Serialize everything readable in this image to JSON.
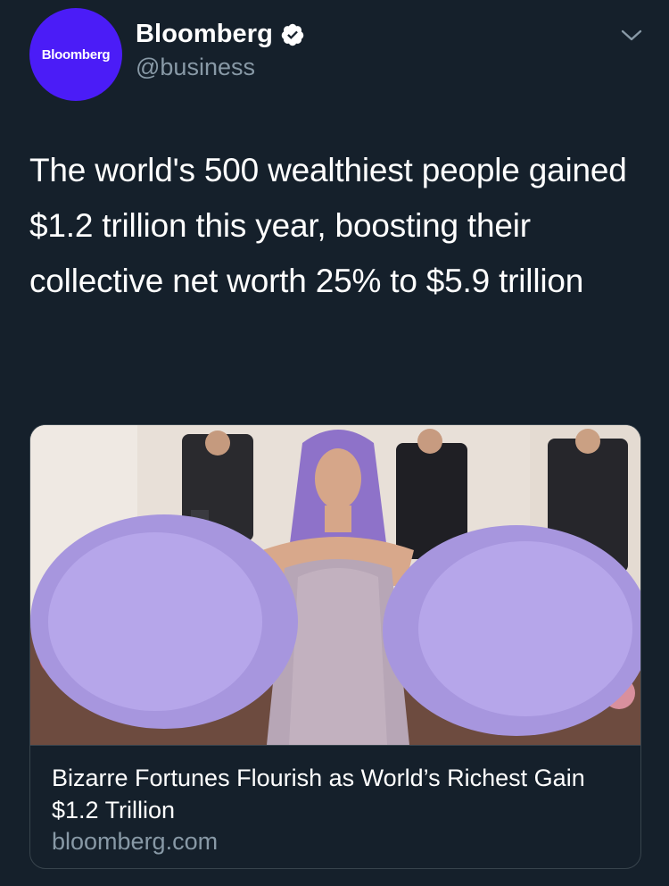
{
  "tweet": {
    "avatar_text": "Bloomberg",
    "display_name": "Bloomberg",
    "handle": "@business",
    "text": "The world's 500 wealthiest people gained $1.2 trillion this year, boosting their collective net worth 25% to $5.9 trillion",
    "verified": true
  },
  "card": {
    "title": "Bizarre Fortunes Flourish as World’s Richest Gain $1.2 Trillion",
    "domain": "bloomberg.com"
  },
  "icons": {
    "verified": "verified-badge-icon",
    "menu": "chevron-down-icon"
  },
  "colors": {
    "background": "#15202b",
    "avatar": "#4b1cf7",
    "secondary_text": "#8899a6",
    "border": "#38444d"
  }
}
